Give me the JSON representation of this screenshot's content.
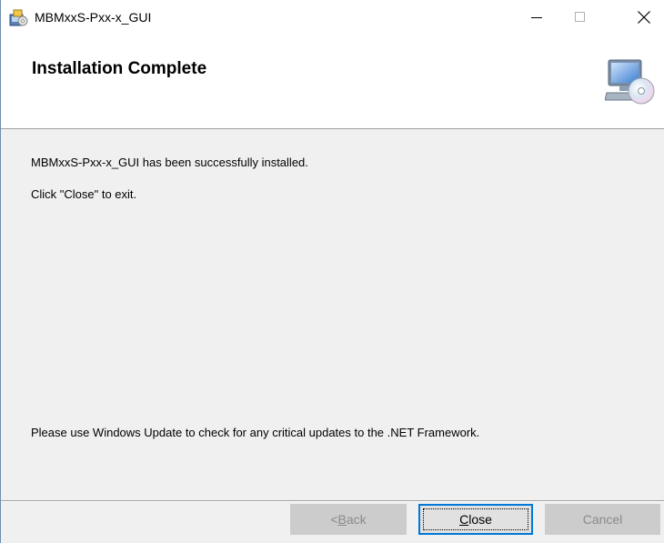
{
  "window": {
    "title": "MBMxxS-Pxx-x_GUI",
    "icon": "installer-icon",
    "controls": [
      "minimize-icon",
      "maximize-icon",
      "close-icon"
    ]
  },
  "banner": {
    "title": "Installation Complete",
    "icon": "computer-cd-icon"
  },
  "content": {
    "line1": "MBMxxS-Pxx-x_GUI has been successfully installed.",
    "line2": "Click \"Close\" to exit.",
    "line3": "Please use Windows Update to check for any critical updates to the .NET Framework."
  },
  "buttons": {
    "back_prefix": "< ",
    "back_access": "B",
    "back_rest": "ack",
    "close_access": "C",
    "close_rest": "lose",
    "cancel": "Cancel"
  },
  "colors": {
    "accent": "#0078d7",
    "dialog_bg": "#f0f0f0",
    "disabled_button": "#cccccc"
  }
}
